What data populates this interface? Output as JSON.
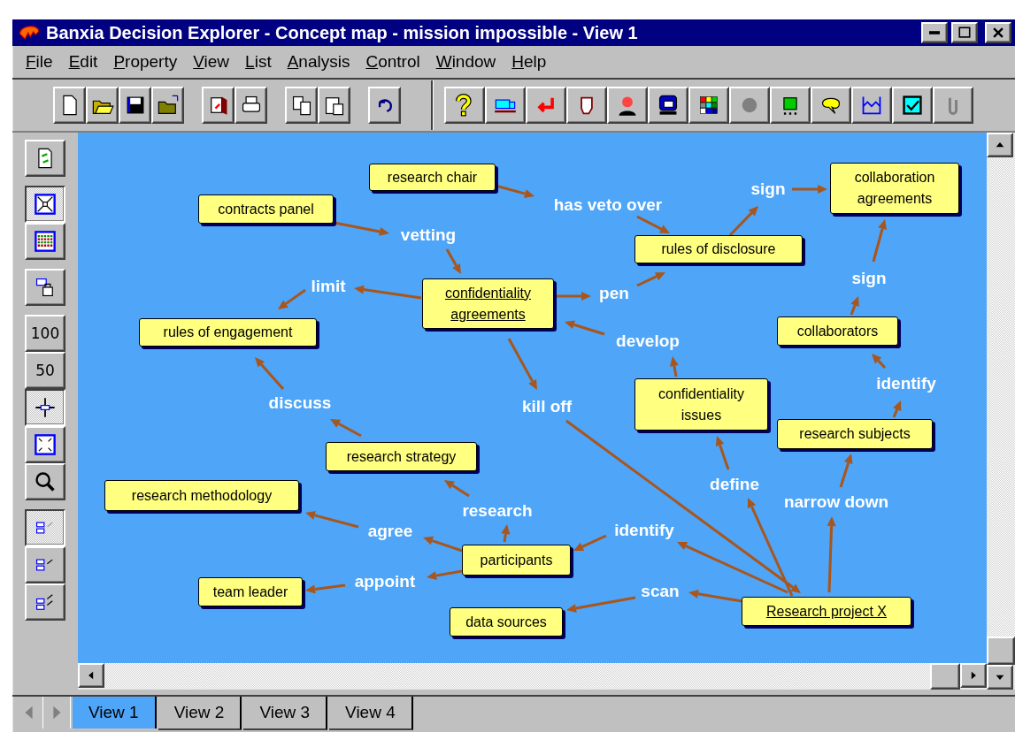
{
  "window": {
    "title": "Banxia Decision Explorer - Concept map - mission impossible - View 1"
  },
  "menu": [
    "File",
    "Edit",
    "Property",
    "View",
    "List",
    "Analysis",
    "Control",
    "Window",
    "Help"
  ],
  "left_toolbar": [
    {
      "kind": "icon",
      "pressed": false
    },
    {
      "kind": "icon",
      "pressed": true
    },
    {
      "kind": "icon",
      "pressed": false
    },
    {
      "kind": "icon",
      "pressed": false
    },
    {
      "kind": "text",
      "label": "100",
      "pressed": false
    },
    {
      "kind": "text",
      "label": "50",
      "pressed": false
    },
    {
      "kind": "icon",
      "pressed": true
    },
    {
      "kind": "icon",
      "pressed": false
    },
    {
      "kind": "icon",
      "pressed": false
    },
    {
      "kind": "icon",
      "pressed": true
    },
    {
      "kind": "icon",
      "pressed": false
    },
    {
      "kind": "icon",
      "pressed": false
    }
  ],
  "concepts": [
    {
      "text": "research chair",
      "underlined": false
    },
    {
      "text": "contracts panel",
      "underlined": false
    },
    {
      "text": "collaboration agreements",
      "underlined": false
    },
    {
      "text": "rules of disclosure",
      "underlined": false
    },
    {
      "text": "confidentiality agreements",
      "underlined": true
    },
    {
      "text": "rules of engagement",
      "underlined": false
    },
    {
      "text": "collaborators",
      "underlined": false
    },
    {
      "text": "confidentiality issues",
      "underlined": false
    },
    {
      "text": "research subjects",
      "underlined": false
    },
    {
      "text": "research strategy",
      "underlined": false
    },
    {
      "text": "research methodology",
      "underlined": false
    },
    {
      "text": "participants",
      "underlined": false
    },
    {
      "text": "team leader",
      "underlined": false
    },
    {
      "text": "data sources",
      "underlined": false
    },
    {
      "text": "Research project X",
      "underlined": true
    }
  ],
  "links": [
    "has veto over",
    "sign",
    "vetting",
    "limit",
    "pen",
    "sign",
    "develop",
    "identify",
    "discuss",
    "kill off",
    "define",
    "research",
    "narrow down",
    "agree",
    "identify",
    "appoint",
    "scan"
  ],
  "tabs": [
    {
      "label": "View 1",
      "selected": true
    },
    {
      "label": "View 2",
      "selected": false
    },
    {
      "label": "View 3",
      "selected": false
    },
    {
      "label": "View 4",
      "selected": false
    }
  ]
}
